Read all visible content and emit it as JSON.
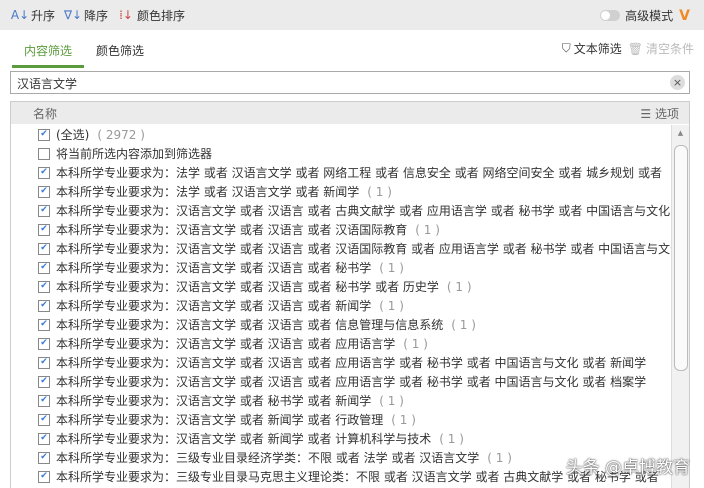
{
  "toolbar": {
    "asc": "升序",
    "desc": "降序",
    "color_sort": "颜色排序",
    "advanced": "高级模式",
    "logo": "V"
  },
  "tabs": {
    "content": "内容筛选",
    "color": "颜色筛选",
    "text_filter": "文本筛选",
    "clear": "清空条件"
  },
  "search": {
    "value": "汉语言文学",
    "clear": "×"
  },
  "list": {
    "header_name": "名称",
    "header_options": "选项",
    "rows": [
      {
        "text": "(全选)",
        "count": "( 2972 )",
        "checked": true
      },
      {
        "text": "将当前所选内容添加到筛选器",
        "count": "",
        "checked": false
      },
      {
        "text": "本科所学专业要求为：法学 或者 汉语言文学 或者 网络工程 或者 信息安全 或者 网络空间安全 或者 城乡规划 或者",
        "count": "",
        "checked": true
      },
      {
        "text": "本科所学专业要求为：法学 或者 汉语言文学 或者 新闻学",
        "count": "( 1 )",
        "checked": true
      },
      {
        "text": "本科所学专业要求为：汉语言文学 或者 汉语言 或者 古典文献学 或者 应用语言学 或者 秘书学 或者 中国语言与文化",
        "count": "",
        "checked": true
      },
      {
        "text": "本科所学专业要求为：汉语言文学 或者 汉语言 或者 汉语国际教育",
        "count": "( 1 )",
        "checked": true
      },
      {
        "text": "本科所学专业要求为：汉语言文学 或者 汉语言 或者 汉语国际教育 或者 应用语言学 或者 秘书学 或者 中国语言与文化",
        "count": "",
        "checked": true
      },
      {
        "text": "本科所学专业要求为：汉语言文学 或者 汉语言 或者 秘书学",
        "count": "( 1 )",
        "checked": true
      },
      {
        "text": "本科所学专业要求为：汉语言文学 或者 汉语言 或者 秘书学 或者 历史学",
        "count": "( 1 )",
        "checked": true
      },
      {
        "text": "本科所学专业要求为：汉语言文学 或者 汉语言 或者 新闻学",
        "count": "( 1 )",
        "checked": true
      },
      {
        "text": "本科所学专业要求为：汉语言文学 或者 汉语言 或者 信息管理与信息系统",
        "count": "( 1 )",
        "checked": true
      },
      {
        "text": "本科所学专业要求为：汉语言文学 或者 汉语言 或者 应用语言学",
        "count": "( 1 )",
        "checked": true
      },
      {
        "text": "本科所学专业要求为：汉语言文学 或者 汉语言 或者 应用语言学 或者 秘书学 或者 中国语言与文化 或者 新闻学",
        "count": "",
        "checked": true
      },
      {
        "text": "本科所学专业要求为：汉语言文学 或者 汉语言 或者 应用语言学 或者 秘书学 或者 中国语言与文化 或者 档案学",
        "count": "",
        "checked": true
      },
      {
        "text": "本科所学专业要求为：汉语言文学 或者 秘书学 或者 新闻学",
        "count": "( 1 )",
        "checked": true
      },
      {
        "text": "本科所学专业要求为：汉语言文学 或者 新闻学 或者 行政管理",
        "count": "( 1 )",
        "checked": true
      },
      {
        "text": "本科所学专业要求为：汉语言文学 或者 新闻学 或者 计算机科学与技术",
        "count": "( 1 )",
        "checked": true
      },
      {
        "text": "本科所学专业要求为：三级专业目录经济学类：不限 或者 法学 或者 汉语言文学",
        "count": "( 1 )",
        "checked": true
      },
      {
        "text": "本科所学专业要求为：三级专业目录马克思主义理论类：不限 或者 汉语言文学 或者 古典文献学 或者 秘书学 或者",
        "count": "",
        "checked": true
      }
    ]
  },
  "watermark": "头条 @卓博教育"
}
